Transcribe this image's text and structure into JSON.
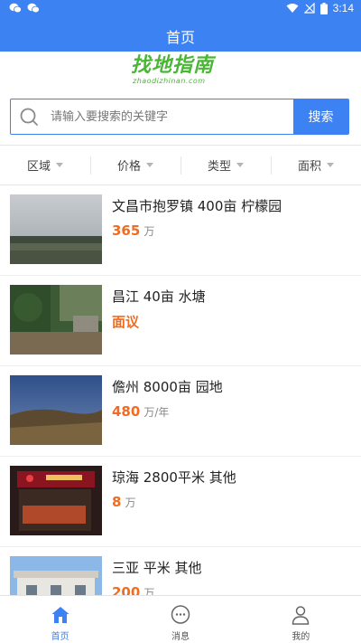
{
  "status_bar": {
    "time": "3:14"
  },
  "header": {
    "title": "首页"
  },
  "logo": {
    "text": "找地指南",
    "sub": "zhaodizhinan.com"
  },
  "search": {
    "placeholder": "请输入要搜索的关键字",
    "button_label": "搜索"
  },
  "filters": [
    {
      "label": "区域"
    },
    {
      "label": "价格"
    },
    {
      "label": "类型"
    },
    {
      "label": "面积"
    }
  ],
  "listings": [
    {
      "title": "文昌市抱罗镇 400亩 柠檬园",
      "price": "365",
      "unit": "万"
    },
    {
      "title": "昌江 40亩 水塘",
      "price": "面议",
      "unit": ""
    },
    {
      "title": "儋州 8000亩 园地",
      "price": "480",
      "unit": "万/年"
    },
    {
      "title": "琼海 2800平米 其他",
      "price": "8",
      "unit": "万"
    },
    {
      "title": "三亚 平米 其他",
      "price": "200",
      "unit": "万"
    }
  ],
  "bottom_nav": [
    {
      "label": "首页",
      "icon": "home-icon",
      "active": true
    },
    {
      "label": "消息",
      "icon": "message-icon",
      "active": false
    },
    {
      "label": "我的",
      "icon": "user-icon",
      "active": false
    }
  ],
  "colors": {
    "primary": "#3d82f3",
    "price": "#f26b21",
    "logo": "#49b635"
  }
}
